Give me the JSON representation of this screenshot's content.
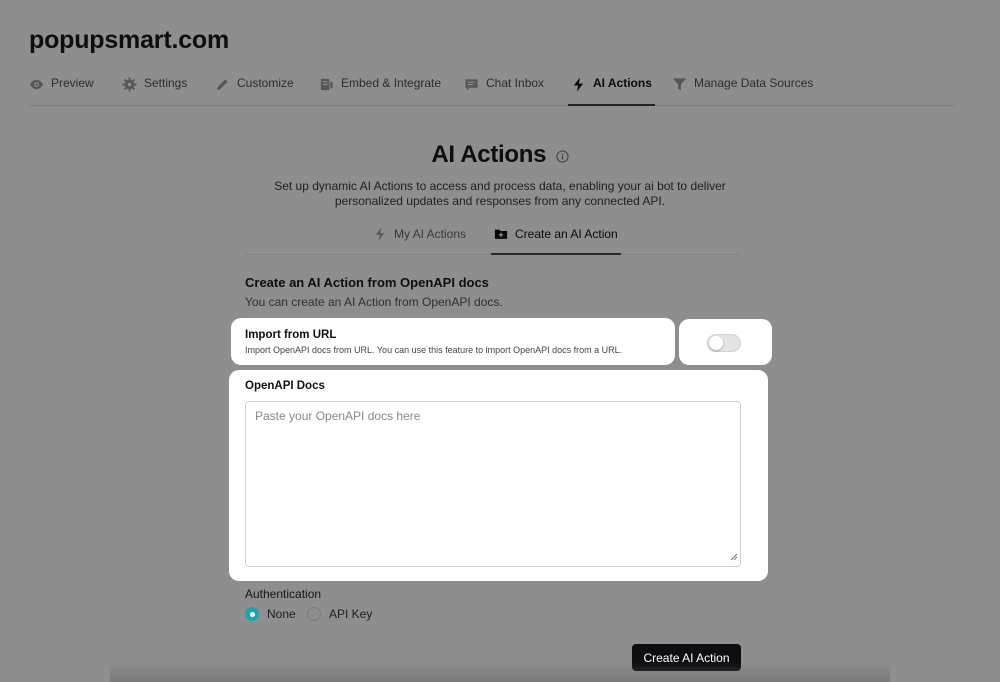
{
  "site": {
    "title": "popupsmart.com"
  },
  "top_tabs": [
    {
      "label": "Preview",
      "icon": "eye-icon"
    },
    {
      "label": "Settings",
      "icon": "gear-icon"
    },
    {
      "label": "Customize",
      "icon": "pencil-icon"
    },
    {
      "label": "Embed & Integrate",
      "icon": "embed-icon"
    },
    {
      "label": "Chat Inbox",
      "icon": "chat-icon"
    },
    {
      "label": "AI Actions",
      "icon": "bolt-icon",
      "active": true
    },
    {
      "label": "Manage Data Sources",
      "icon": "funnel-icon"
    }
  ],
  "page": {
    "title": "AI Actions",
    "description": "Set up dynamic AI Actions to access and process data, enabling your ai bot to deliver personalized updates and responses from any connected API."
  },
  "sub_tabs": [
    {
      "label": "My AI Actions",
      "icon": "bolt-icon"
    },
    {
      "label": "Create an AI Action",
      "icon": "folder-plus-icon",
      "active": true
    }
  ],
  "form": {
    "section_title": "Create an AI Action from OpenAPI docs",
    "section_desc": "You can create an AI Action from OpenAPI docs.",
    "import_url": {
      "title": "Import from URL",
      "desc": "Import OpenAPI docs from URL. You can use this feature to import OpenAPI docs from a URL.",
      "enabled": false
    },
    "docs": {
      "label": "OpenAPI Docs",
      "placeholder": "Paste your OpenAPI docs here",
      "value": ""
    },
    "auth": {
      "label": "Authentication",
      "options": [
        {
          "label": "None",
          "selected": true
        },
        {
          "label": "API Key",
          "selected": false
        }
      ]
    },
    "submit_label": "Create AI Action"
  },
  "colors": {
    "overlay": "#8e8e8e",
    "accent": "#1aa3b5",
    "button": "#0e0e12"
  }
}
